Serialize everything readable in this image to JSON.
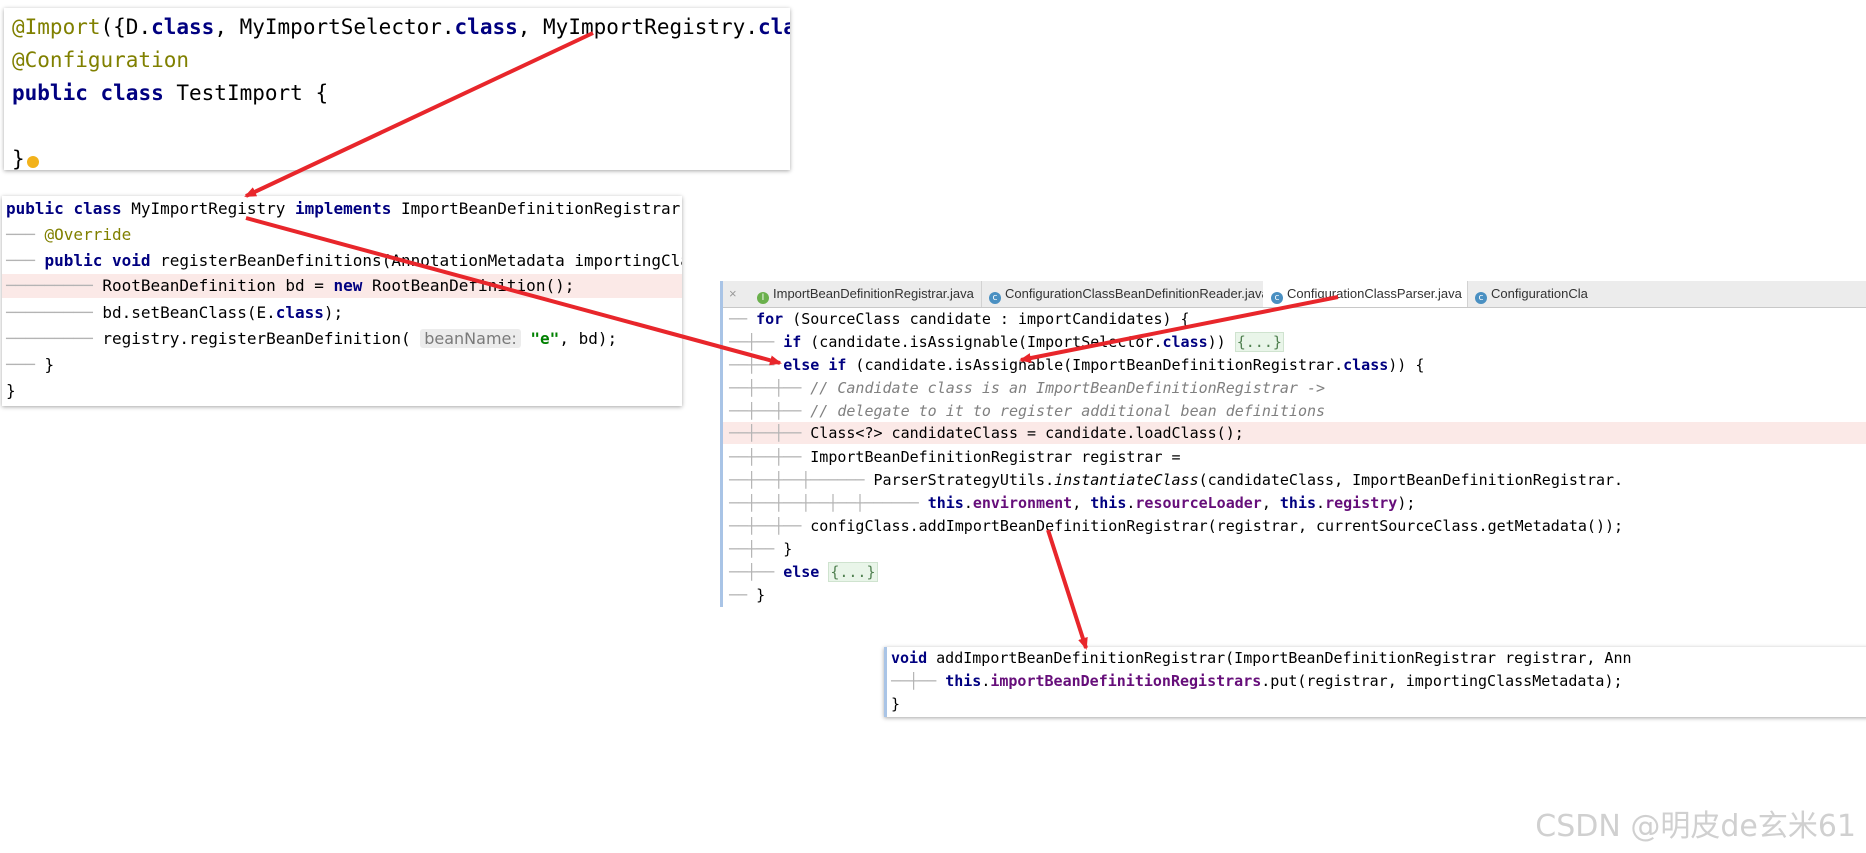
{
  "panel1": {
    "l1": {
      "a": "@Import",
      "b": "({D.",
      "c": "class",
      ",": ", MyImportSelector.",
      "e": "class",
      "f": ", MyImportRegistry.",
      "g": "class",
      "h": "})"
    },
    "l2": "@Configuration",
    "l3": {
      "a": "public",
      "b": "class",
      "c": " TestImport {"
    },
    "l4": "}"
  },
  "panel2": {
    "l1": {
      "a": "public",
      "b": "class",
      "c": " MyImportRegistry ",
      "d": "implements",
      "e": " ImportBeanDefinitionRegistrar {"
    },
    "l2": "@Override",
    "l3": {
      "a": "public",
      "b": "void",
      "c": " registerBeanDefinitions(AnnotationMetadata importingClas"
    },
    "l4": {
      "a": "RootBeanDefinition bd = ",
      "b": "new",
      "c": " RootBeanDefinition();"
    },
    "l5": {
      "a": "bd.setBeanClass(E.",
      "b": "class",
      "c": ");"
    },
    "l6": {
      "a": "registry.registerBeanDefinition( ",
      "hint": "beanName:",
      "c": " ",
      "str": "\"e\"",
      "d": ", bd);"
    },
    "l7": "}",
    "l8": "}"
  },
  "panel3": {
    "tabs": [
      {
        "label": "ImportBeanDefinitionRegistrar.java",
        "icon": "interface-icon",
        "color": "#6ab04c",
        "glyph": "I"
      },
      {
        "label": "ConfigurationClassBeanDefinitionReader.java",
        "icon": "class-icon",
        "color": "#4a90c2",
        "glyph": "c"
      },
      {
        "label": "ConfigurationClassParser.java",
        "icon": "class-icon",
        "color": "#4a90c2",
        "glyph": "c"
      },
      {
        "label": "ConfigurationCla",
        "icon": "class-icon",
        "color": "#4a90c2",
        "glyph": "c"
      }
    ],
    "close_glyph": "×",
    "l1": {
      "a": "for",
      "b": " (SourceClass candidate : importCandidates) {"
    },
    "l2": {
      "a": "if",
      "b": " (candidate.isAssignable(ImportSelector.",
      "c": "class",
      "d": ")) ",
      "e": "{...}"
    },
    "l3": {
      "a": "else if",
      "b": " (candidate.isAssignable(ImportBeanDefinitionRegistrar.",
      "c": "class",
      "d": ")) {"
    },
    "l4": "// Candidate class is an ImportBeanDefinitionRegistrar ->",
    "l5": "// delegate to it to register additional bean definitions",
    "l6": "Class<?> candidateClass = candidate.loadClass();",
    "l7": "ImportBeanDefinitionRegistrar registrar =",
    "l8": {
      "a": "ParserStrategyUtils.",
      "b": "instantiateClass",
      "c": "(candidateClass, ImportBeanDefinitionRegistrar."
    },
    "l9": {
      "a": "this",
      "b": ".",
      "c": "environment",
      ",": ", ",
      "e": "this",
      "f": ".",
      "g": "resourceLoader",
      "h": ", ",
      "i": "this",
      "j": ".",
      "k": "registry",
      "m": ");"
    },
    "l10": "configClass.addImportBeanDefinitionRegistrar(registrar, currentSourceClass.getMetadata());",
    "l11": "}",
    "l12": {
      "a": "else",
      "b": " ",
      "c": "{...}"
    },
    "l13": "}"
  },
  "panel4": {
    "l1": {
      "a": "void",
      "b": " addImportBeanDefinitionRegistrar(ImportBeanDefinitionRegistrar registrar, Ann"
    },
    "l2": {
      "a": "this",
      "b": ".",
      "c": "importBeanDefinitionRegistrars",
      "d": ".put(registrar, importingClassMetadata);"
    },
    "l3": "}"
  },
  "watermark": "CSDN @明皮de玄米61",
  "colors": {
    "arrow": "#e8262b",
    "keyword": "#000080",
    "annotation": "#808000",
    "string": "#008000",
    "field": "#660e7a"
  }
}
